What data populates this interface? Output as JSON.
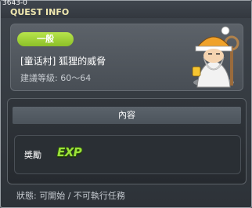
{
  "window": {
    "quest_id": "3643-0",
    "title": "QUEST INFO"
  },
  "quest": {
    "category": "一般",
    "name": "[童话村] 狐狸的威脅",
    "level_range": "建議等級: 60～64",
    "npc_icon": "npc-old-man-icon"
  },
  "content": {
    "header": "內容",
    "reward_label": "獎勵",
    "reward_exp": "EXP"
  },
  "status": "狀態: 可開始 / 不可執行任務",
  "colors": {
    "category_pill": "#9ccf34",
    "exp_text": "#9be23a",
    "title_text": "#f0e8b0"
  }
}
